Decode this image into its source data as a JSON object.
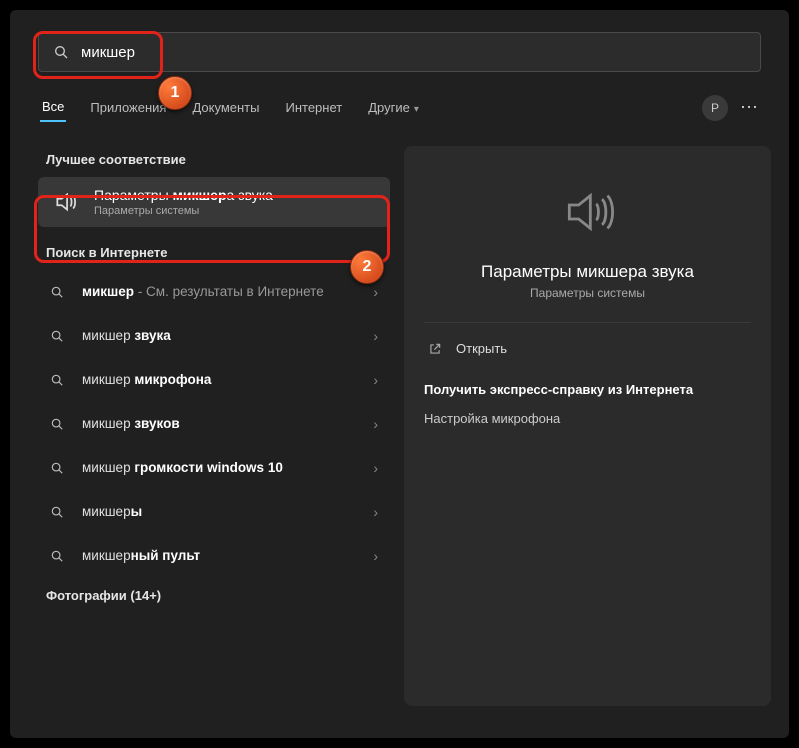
{
  "search": {
    "value": "микшер"
  },
  "tabs": {
    "all": "Все",
    "apps": "Приложения",
    "docs": "Документы",
    "internet": "Интернет",
    "more": "Другие"
  },
  "avatar_initial": "P",
  "left": {
    "best_label": "Лучшее соответствие",
    "best_match": {
      "title_pre": "Параметры ",
      "title_bold": "микшер",
      "title_post": "а звука",
      "subtitle": "Параметры системы"
    },
    "web_label": "Поиск в Интернете",
    "web_items": [
      {
        "pre": "",
        "bold": "микшер",
        "post": "",
        "tail": " - См. результаты в Интернете"
      },
      {
        "pre": "микшер ",
        "bold": "звука",
        "post": "",
        "tail": ""
      },
      {
        "pre": "микшер ",
        "bold": "микрофона",
        "post": "",
        "tail": ""
      },
      {
        "pre": "микшер ",
        "bold": "звуков",
        "post": "",
        "tail": ""
      },
      {
        "pre": "микшер ",
        "bold": "громкости windows 10",
        "post": "",
        "tail": ""
      },
      {
        "pre": "микшер",
        "bold": "ы",
        "post": "",
        "tail": ""
      },
      {
        "pre": "микшер",
        "bold": "ный пульт",
        "post": "",
        "tail": ""
      }
    ],
    "photos_label": "Фотографии (14+)"
  },
  "right": {
    "title": "Параметры микшера звука",
    "subtitle": "Параметры системы",
    "open": "Открыть",
    "help_label": "Получить экспресс-справку из Интернета",
    "help_link": "Настройка микрофона"
  },
  "callouts": {
    "one": "1",
    "two": "2"
  }
}
